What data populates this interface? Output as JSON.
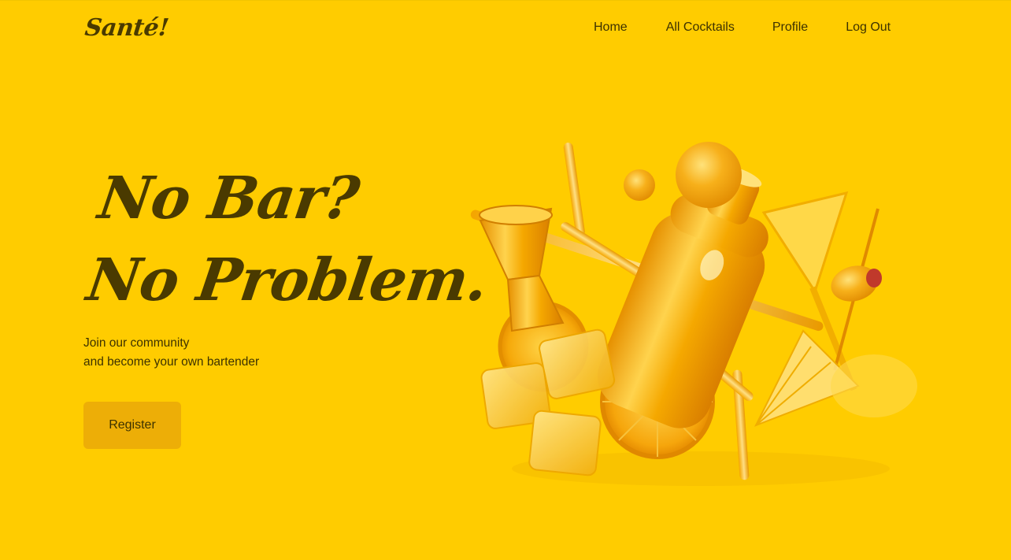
{
  "brand": {
    "logo": "Santé!"
  },
  "nav": {
    "items": [
      {
        "label": "Home"
      },
      {
        "label": "All Cocktails"
      },
      {
        "label": "Profile"
      },
      {
        "label": "Log Out"
      }
    ]
  },
  "hero": {
    "headline_line1": "No Bar?",
    "headline_line2": "No Problem.",
    "subtext_line1": "Join our community",
    "subtext_line2": "and become your own bartender",
    "register_label": "Register",
    "illustration_icon": "cocktail-tools-illustration"
  },
  "colors": {
    "background": "#FFCC00",
    "text_dark": "#4a3a00",
    "button": "#EDAE07",
    "accent_orange": "#F39C12"
  }
}
